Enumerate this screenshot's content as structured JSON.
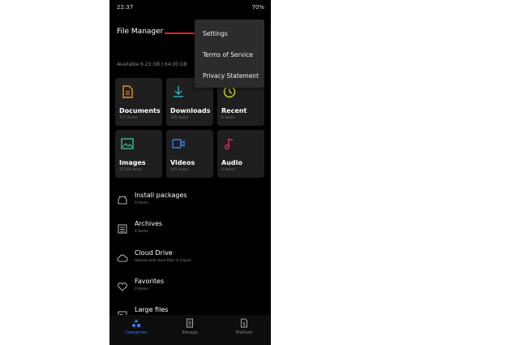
{
  "status_bar": {
    "time": "22:37",
    "right": "70%"
  },
  "header": {
    "title": "File Manager"
  },
  "menu": {
    "items": [
      "Settings",
      "Terms of Service",
      "Privacy Statement"
    ]
  },
  "storage": {
    "text": "Available 6.23 GB / 64.00 GB"
  },
  "tiles": [
    {
      "name": "Documents",
      "count": "717 items",
      "icon": "document-icon",
      "color": "#f08a24"
    },
    {
      "name": "Downloads",
      "count": "335 items",
      "icon": "download-icon",
      "color": "#2ab3c0"
    },
    {
      "name": "Recent",
      "count": "0 items",
      "icon": "clock-icon",
      "color": "#c9d82a"
    },
    {
      "name": "Images",
      "count": "15128 items",
      "icon": "image-icon",
      "color": "#3fbf8f"
    },
    {
      "name": "Videos",
      "count": "415 items",
      "icon": "video-icon",
      "color": "#3f7be6"
    },
    {
      "name": "Audio",
      "count": "0 items",
      "icon": "music-icon",
      "color": "#e0306a"
    }
  ],
  "list": [
    {
      "name": "Install packages",
      "count": "0 items",
      "icon": "android-icon"
    },
    {
      "name": "Archives",
      "count": "4 items",
      "icon": "archive-icon"
    },
    {
      "name": "Cloud Drive",
      "count": "Upload and store files in Cloud",
      "icon": "cloud-icon"
    },
    {
      "name": "Favorites",
      "count": "0 items",
      "icon": "heart-icon"
    },
    {
      "name": "Large files",
      "count": "",
      "icon": "large-files-icon"
    }
  ],
  "bottom_nav": [
    {
      "label": "Categories",
      "icon": "categories-icon",
      "active": true,
      "color": "#2f7bf5"
    },
    {
      "label": "Storage",
      "icon": "storage-icon",
      "active": false
    },
    {
      "label": "FileDash",
      "icon": "filedash-icon",
      "active": false
    }
  ]
}
